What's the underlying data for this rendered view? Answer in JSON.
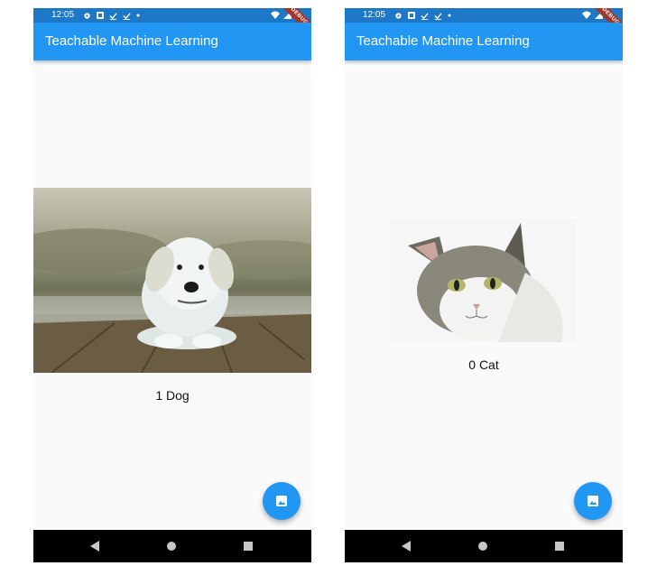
{
  "left_screen": {
    "status": {
      "time": "12:05",
      "debug_banner": "DEBUG"
    },
    "app_bar": {
      "title": "Teachable Machine Learning"
    },
    "result": "1 Dog",
    "fab_icon": "image-icon",
    "nav": {
      "back_icon": "back-triangle-icon",
      "home_icon": "home-circle-icon",
      "recents_icon": "recents-square-icon"
    }
  },
  "right_screen": {
    "status": {
      "time": "12:05",
      "debug_banner": "DEBUG"
    },
    "app_bar": {
      "title": "Teachable Machine Learning"
    },
    "result": "0 Cat",
    "fab_icon": "image-icon",
    "nav": {
      "back_icon": "back-triangle-icon",
      "home_icon": "home-circle-icon",
      "recents_icon": "recents-square-icon"
    }
  },
  "colors": {
    "app_bar": "#2196f3",
    "status_bar": "#1e78c8",
    "fab": "#2196f3",
    "nav_bar": "#000000",
    "background": "#fafafa"
  }
}
